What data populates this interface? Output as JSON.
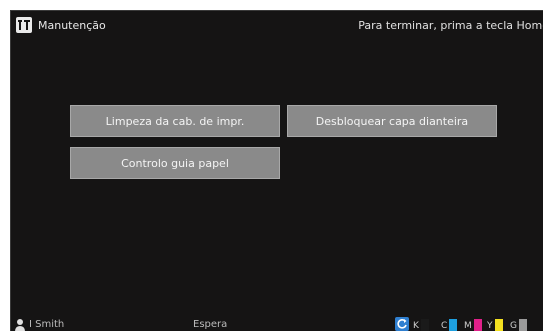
{
  "header": {
    "title": "Manutenção",
    "hint": "Para terminar, prima a tecla Home",
    "icon": "maintenance-icon"
  },
  "buttons": {
    "head_cleaning": "Limpeza da cab. de impr.",
    "unlock_front_cover": "Desbloquear capa dianteira",
    "paper_guide_control": "Controlo guia papel"
  },
  "status": {
    "user": "I Smith",
    "state": "Espera",
    "refresh_icon": "refresh-icon",
    "inks": [
      {
        "label": "K",
        "color": "#1a1a1a",
        "level": 1.0
      },
      {
        "label": "C",
        "color": "#1ea0e0",
        "level": 1.0
      },
      {
        "label": "M",
        "color": "#e0208a",
        "level": 1.0
      },
      {
        "label": "Y",
        "color": "#f4e020",
        "level": 1.0
      },
      {
        "label": "G",
        "color": "#9a9a9a",
        "level": 1.0
      }
    ]
  },
  "colors": {
    "background": "#151414",
    "button": "#8a8a8a",
    "accent": "#2f7fd0"
  }
}
